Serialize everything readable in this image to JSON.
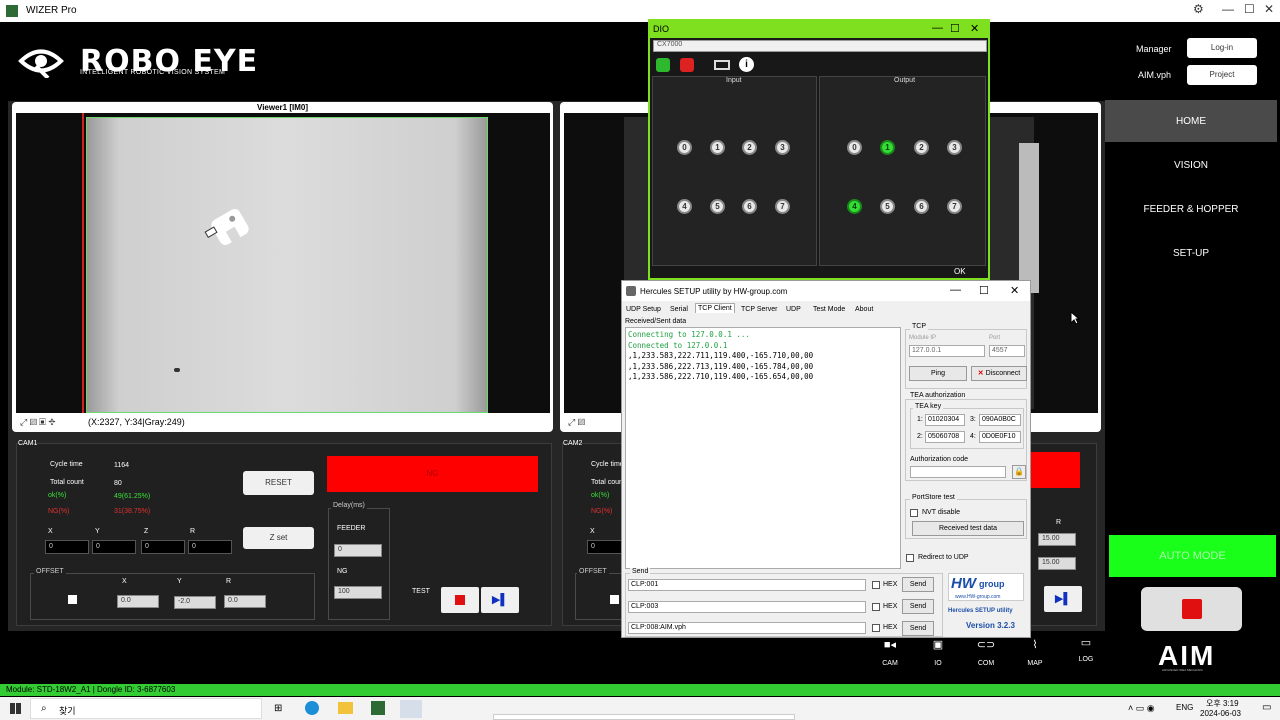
{
  "window": {
    "title": "WIZER Pro"
  },
  "brand": {
    "name": "ROBO EYE",
    "tagline": "INTELLIGENT ROBOTIC VISION SYSTEM",
    "bottom_logo": "AIM",
    "bottom_logo_sub": "ADVANCED IDEA MECHANIC"
  },
  "top_right": {
    "user_label": "Manager",
    "login_button": "Log-in",
    "project_label": "AIM.vph",
    "project_button": "Project"
  },
  "viewer1": {
    "title": "Viewer1 [IM0]",
    "status": "(X:2327, Y:34|Gray:249)"
  },
  "cam1": {
    "title": "CAM1",
    "cycle_time_label": "Cycle time",
    "cycle_time": "1164",
    "total_count_label": "Total count",
    "total_count": "80",
    "ok_label": "ok(%)",
    "ok_value": "49(61.25%)",
    "ng_label": "NG(%)",
    "ng_value": "31(38.75%)",
    "reset_button": "RESET",
    "zset_button": "Z set",
    "ng_box": "NG",
    "axes": [
      "X",
      "Y",
      "Z",
      "R"
    ],
    "axis_values": [
      "0",
      "0",
      "0",
      "0"
    ],
    "offset_title": "OFFSET",
    "offset_labels": [
      "X",
      "Y",
      "R"
    ],
    "offset_values": [
      "0.0",
      "-2.0",
      "0.0"
    ],
    "delay_title": "Delay(ms)",
    "feeder_label": "FEEDER",
    "feeder_value": "0",
    "ng_delay_label": "NG",
    "ng_delay_value": "100",
    "test_label": "TEST"
  },
  "cam2": {
    "title": "CAM2",
    "cycle_time_label": "Cycle time",
    "total_count_label": "Total count",
    "ok_label": "ok(%)",
    "ng_label": "NG(%)",
    "x_label": "X",
    "axis_value": "0",
    "offset_title": "OFFSET",
    "r_label": "R",
    "spin1": "15.00",
    "spin2": "15.00"
  },
  "menu": {
    "items": [
      "HOME",
      "VISION",
      "FEEDER & HOPPER",
      "SET-UP"
    ],
    "auto_mode": "AUTO MODE"
  },
  "bottom_nav": [
    {
      "label": "CAM",
      "icon": "camera-icon"
    },
    {
      "label": "IO",
      "icon": "chip-icon"
    },
    {
      "label": "COM",
      "icon": "link-icon"
    },
    {
      "label": "MAP",
      "icon": "chart-icon"
    },
    {
      "label": "LOG",
      "icon": "monitor-icon"
    }
  ],
  "dio": {
    "title": "DIO",
    "device": "CX7000",
    "input_label": "Input",
    "output_label": "Output",
    "ok_button": "OK",
    "input_pins": [
      "0",
      "1",
      "2",
      "3",
      "4",
      "5",
      "6",
      "7"
    ],
    "output_pins": [
      "0",
      "1",
      "2",
      "3",
      "4",
      "5",
      "6",
      "7"
    ],
    "output_active": [
      1,
      4
    ]
  },
  "hercules": {
    "title": "Hercules SETUP utility by HW-group.com",
    "tabs": [
      "UDP Setup",
      "Serial",
      "TCP Client",
      "TCP Server",
      "UDP",
      "Test Mode",
      "About"
    ],
    "active_tab": "TCP Client",
    "received_label": "Received/Sent data",
    "lines": [
      {
        "text": "Connecting to 127.0.0.1 ...",
        "kind": "status"
      },
      {
        "text": "Connected to 127.0.0.1",
        "kind": "status"
      },
      {
        "text": ",1,233.583,222.711,119.400,-165.710,00,00",
        "kind": "data"
      },
      {
        "text": ",1,233.586,222.713,119.400,-165.784,00,00",
        "kind": "data"
      },
      {
        "text": ",1,233.586,222.710,119.400,-165.654,00,00",
        "kind": "data"
      }
    ],
    "tcp_title": "TCP",
    "module_ip_label": "Module IP",
    "module_ip": "127.0.0.1",
    "port_label": "Port",
    "port": "4557",
    "ping_button": "Ping",
    "disconnect_button": "Disconnect",
    "tea_title": "TEA authorization",
    "tea_key_title": "TEA key",
    "tea_keys": [
      {
        "n": "1:",
        "v": "01020304"
      },
      {
        "n": "3:",
        "v": "090A0B0C"
      },
      {
        "n": "2:",
        "v": "05060708"
      },
      {
        "n": "4:",
        "v": "0D0E0F10"
      }
    ],
    "auth_code_label": "Authorization code",
    "portstore_title": "PortStore test",
    "nvt_label": "NVT disable",
    "received_test_button": "Received test data",
    "redirect_label": "Redirect to UDP",
    "send_title": "Send",
    "send_rows": [
      {
        "value": "CLP:001",
        "hex": "HEX",
        "button": "Send"
      },
      {
        "value": "CLP:003",
        "hex": "HEX",
        "button": "Send"
      },
      {
        "value": "CLP:008:AIM.vph",
        "hex": "HEX",
        "button": "Send"
      }
    ],
    "logo_main": "HW",
    "logo_sub": "group",
    "logo_url": "www.HW-group.com",
    "product": "Hercules SETUP utility",
    "version": "Version  3.2.3"
  },
  "status_bar": {
    "text": "Module: STD-18W2_A1 | Dongle ID: 3-6877603"
  },
  "taskbar": {
    "search": "찾기",
    "ime": "ENG",
    "time": "오후 3:19",
    "date": "2024-06-03"
  }
}
